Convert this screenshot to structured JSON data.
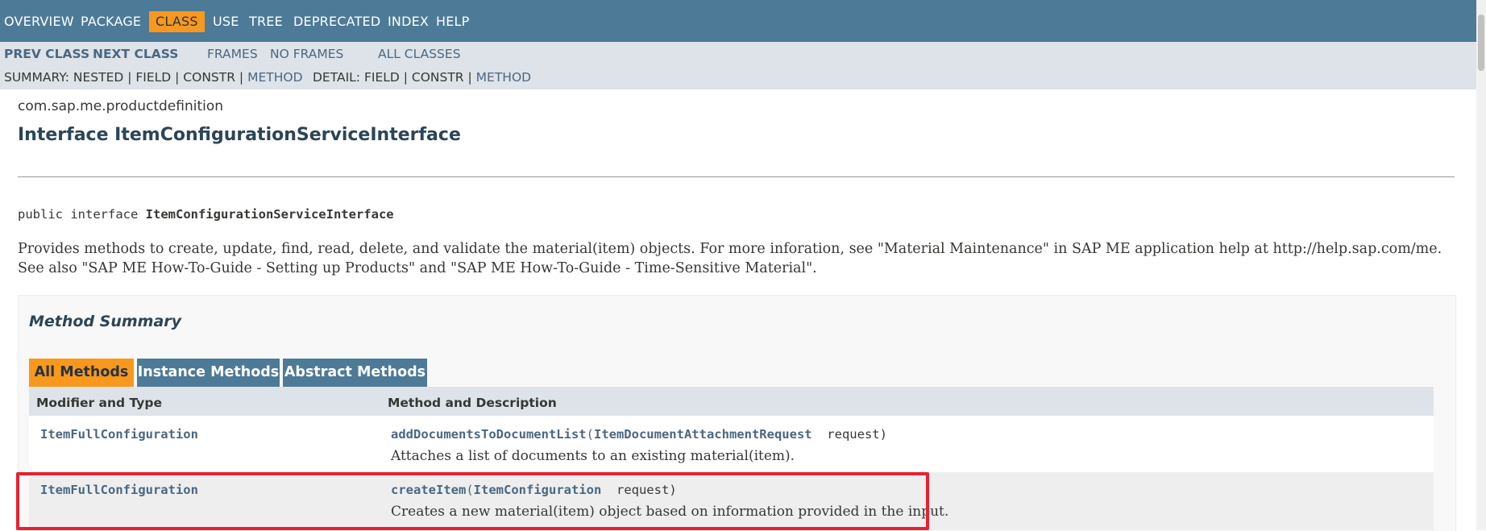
{
  "top_nav": {
    "items": [
      "OVERVIEW",
      "PACKAGE",
      "CLASS",
      "USE",
      "TREE",
      "DEPRECATED",
      "INDEX",
      "HELP"
    ],
    "active": "CLASS"
  },
  "sub_nav": {
    "prev_class": "PREV CLASS",
    "next_class": "NEXT CLASS",
    "frames": "FRAMES",
    "no_frames": "NO FRAMES",
    "all_classes": "ALL CLASSES",
    "summary_prefix": "SUMMARY: NESTED | FIELD | CONSTR |",
    "summary_method": "METHOD",
    "detail_prefix": "DETAIL: FIELD | CONSTR |",
    "detail_method": "METHOD"
  },
  "header": {
    "package": "com.sap.me.productdefinition",
    "title": "Interface ItemConfigurationServiceInterface"
  },
  "signature": {
    "prefix": "public interface",
    "name": "ItemConfigurationServiceInterface"
  },
  "description": "Provides methods to create, update, find, read, delete, and validate the material(item) objects. For more inforation, see \"Material Maintenance\" in SAP ME application help at http://help.sap.com/me. See also \"SAP ME How-To-Guide - Setting up Products\" and \"SAP ME How-To-Guide - Time-Sensitive Material\".",
  "method_summary": {
    "title": "Method Summary",
    "tabs": [
      "All Methods",
      "Instance Methods",
      "Abstract Methods"
    ],
    "active_tab": "All Methods",
    "columns": [
      "Modifier and Type",
      "Method and Description"
    ],
    "rows": [
      {
        "type": "ItemFullConfiguration",
        "method": "addDocumentsToDocumentList",
        "param_type": "ItemDocumentAttachmentRequest",
        "param_name": "request",
        "description": "Attaches a list of documents to an existing material(item)."
      },
      {
        "type": "ItemFullConfiguration",
        "method": "createItem",
        "param_type": "ItemConfiguration",
        "param_name": "request",
        "description": "Creates a new material(item) object based on information provided in the input.",
        "highlighted": true
      }
    ]
  },
  "colors": {
    "nav_bg": "#4d7a97",
    "subnav_bg": "#dee3e9",
    "active_tab": "#f8981d",
    "link": "#4a6782",
    "highlight_border": "#e8212e"
  }
}
